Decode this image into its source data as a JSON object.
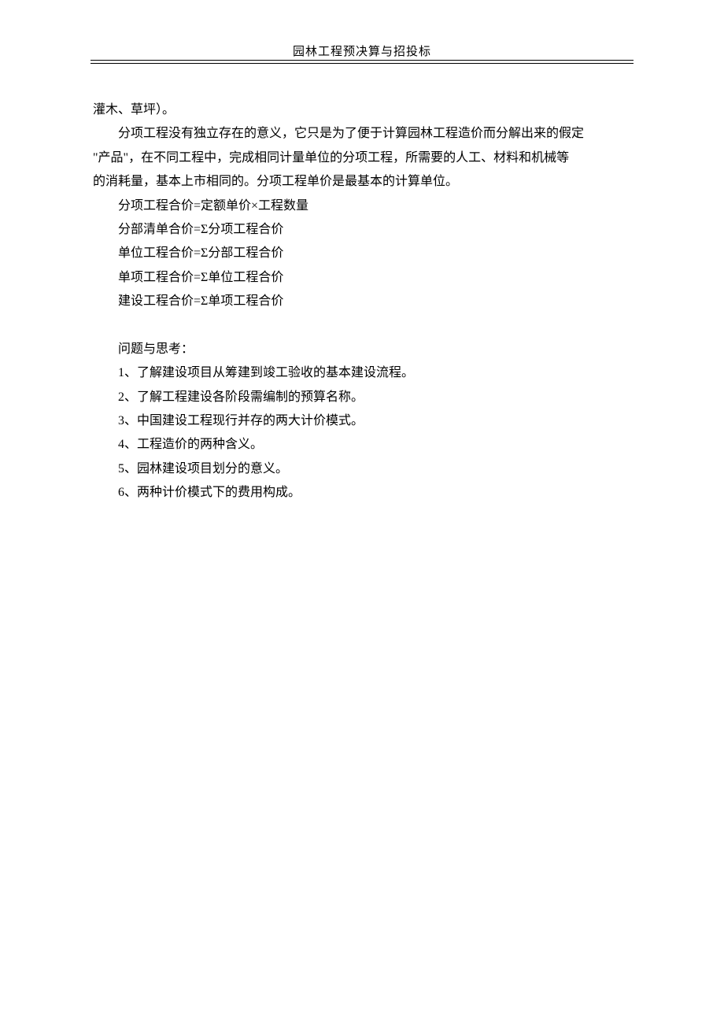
{
  "header": {
    "title": "园林工程预决算与招投标"
  },
  "body": {
    "line1": "灌木、草坪）。",
    "para1_line1": "分项工程没有独立存在的意义，它只是为了便于计算园林工程造价而分解出来的假定",
    "para1_line2": "\"产品\"，在不同工程中，完成相同计量单位的分项工程，所需要的人工、材料和机械等",
    "para1_line3": "的消耗量，基本上市相同的。分项工程单价是最基本的计算单位。",
    "formula1": "分项工程合价=定额单价×工程数量",
    "formula2": "分部清单合价=Σ分项工程合价",
    "formula3": "单位工程合价=Σ分部工程合价",
    "formula4": "单项工程合价=Σ单位工程合价",
    "formula5": "建设工程合价=Σ单项工程合价",
    "questions_heading": "问题与思考：",
    "q1": "1、了解建设项目从筹建到竣工验收的基本建设流程。",
    "q2": "2、了解工程建设各阶段需编制的预算名称。",
    "q3": "3、中国建设工程现行并存的两大计价模式。",
    "q4": "4、工程造价的两种含义。",
    "q5": "5、园林建设项目划分的意义。",
    "q6": "6、两种计价模式下的费用构成。"
  }
}
